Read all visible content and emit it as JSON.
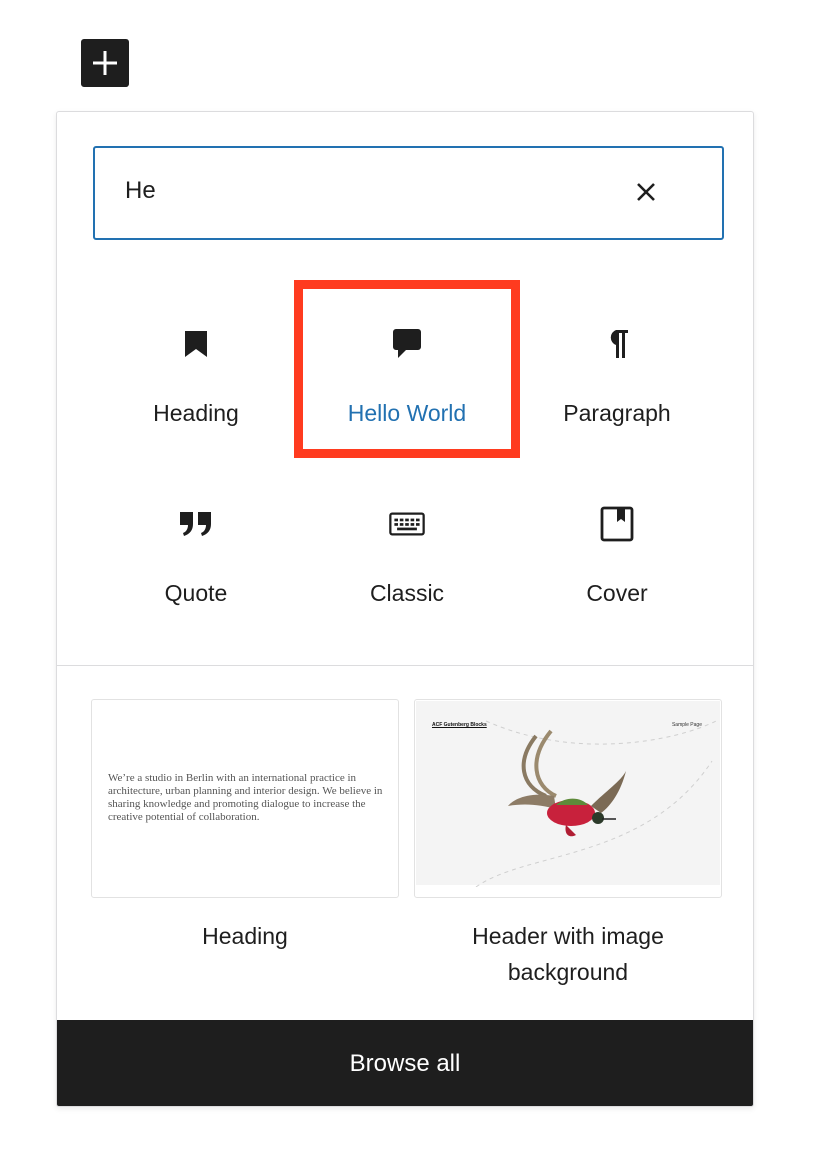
{
  "toolbar": {
    "add_icon": "plus-icon"
  },
  "search": {
    "value": "He",
    "clear_icon": "close-icon"
  },
  "blocks": [
    {
      "label": "Heading",
      "icon": "bookmark-icon"
    },
    {
      "label": "Hello World",
      "icon": "speech-bubble-icon",
      "highlighted": true
    },
    {
      "label": "Paragraph",
      "icon": "pilcrow-icon"
    },
    {
      "label": "Quote",
      "icon": "quote-icon"
    },
    {
      "label": "Classic",
      "icon": "keyboard-icon"
    },
    {
      "label": "Cover",
      "icon": "cover-icon"
    }
  ],
  "patterns": [
    {
      "label": "Heading",
      "preview_text": "We’re a studio in Berlin with an international practice in architecture, urban planning and interior design. We believe in sharing knowledge and promoting dialogue to increase the creative potential of collaboration."
    },
    {
      "label": "Header with image background",
      "preview_title": "ACF Gutenberg Blocks",
      "preview_link": "Sample Page"
    }
  ],
  "footer": {
    "browse_all_label": "Browse all"
  },
  "colors": {
    "accent": "#2271b1",
    "highlight": "#ff3b1f",
    "dark": "#1e1e1e"
  }
}
